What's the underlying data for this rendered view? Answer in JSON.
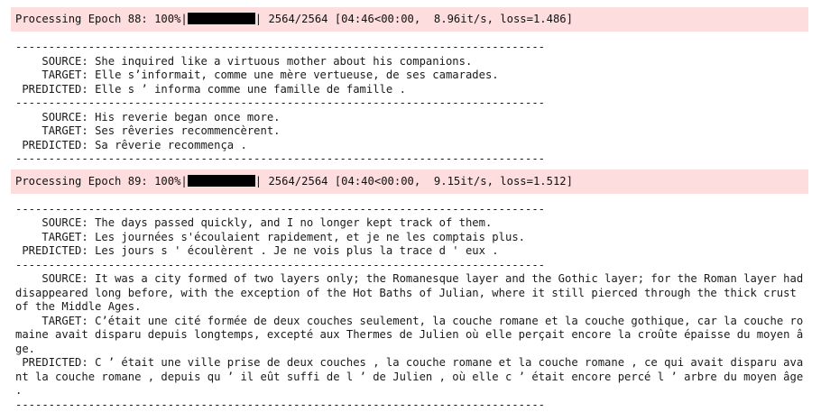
{
  "epochs": [
    {
      "progress": {
        "prefix": "Processing Epoch 88: 100%|",
        "suffix": "| 2564/2564 [04:46<00:00,  8.96it/s, loss=1.486]"
      },
      "samples": [
        {
          "source_label": "    SOURCE: ",
          "source": "She inquired like a virtuous mother about his companions.",
          "target_label": "    TARGET: ",
          "target": "Elle s’informait, comme une mère vertueuse, de ses camarades.",
          "predicted_label": " PREDICTED: ",
          "predicted": "Elle s ’ informa comme une famille de famille ."
        },
        {
          "source_label": "    SOURCE: ",
          "source": "His reverie began once more.",
          "target_label": "    TARGET: ",
          "target": "Ses rêveries recommencèrent.",
          "predicted_label": " PREDICTED: ",
          "predicted": "Sa rêverie recommença ."
        }
      ]
    },
    {
      "progress": {
        "prefix": "Processing Epoch 89: 100%|",
        "suffix": "| 2564/2564 [04:40<00:00,  9.15it/s, loss=1.512]"
      },
      "samples": [
        {
          "source_label": "    SOURCE: ",
          "source": "The days passed quickly, and I no longer kept track of them.",
          "target_label": "    TARGET: ",
          "target": "Les journées s'écoulaient rapidement, et je ne les comptais plus.",
          "predicted_label": " PREDICTED: ",
          "predicted": "Les jours s ' écoulèrent . Je ne vois plus la trace d ' eux ."
        },
        {
          "source_label": "    SOURCE: ",
          "source": "It was a city formed of two layers only; the Romanesque layer and the Gothic layer; for the Roman layer had disappeared long before, with the exception of the Hot Baths of Julian, where it still pierced through the thick crust of the Middle Ages.",
          "target_label": "    TARGET: ",
          "target": "C’était une cité formée de deux couches seulement, la couche romane et la couche gothique, car la couche romaine avait disparu depuis longtemps, excepté aux Thermes de Julien où elle perçait encore la croûte épaisse du moyen âge.",
          "predicted_label": " PREDICTED: ",
          "predicted": "C ’ était une ville prise de deux couches , la couche romane et la couche romane , ce qui avait disparu avant la couche romane , depuis qu ’ il eût suffi de l ’ de Julien , où elle c ’ était encore percé l ’ arbre du moyen âge ."
        }
      ]
    }
  ],
  "separator": "--------------------------------------------------------------------------------"
}
